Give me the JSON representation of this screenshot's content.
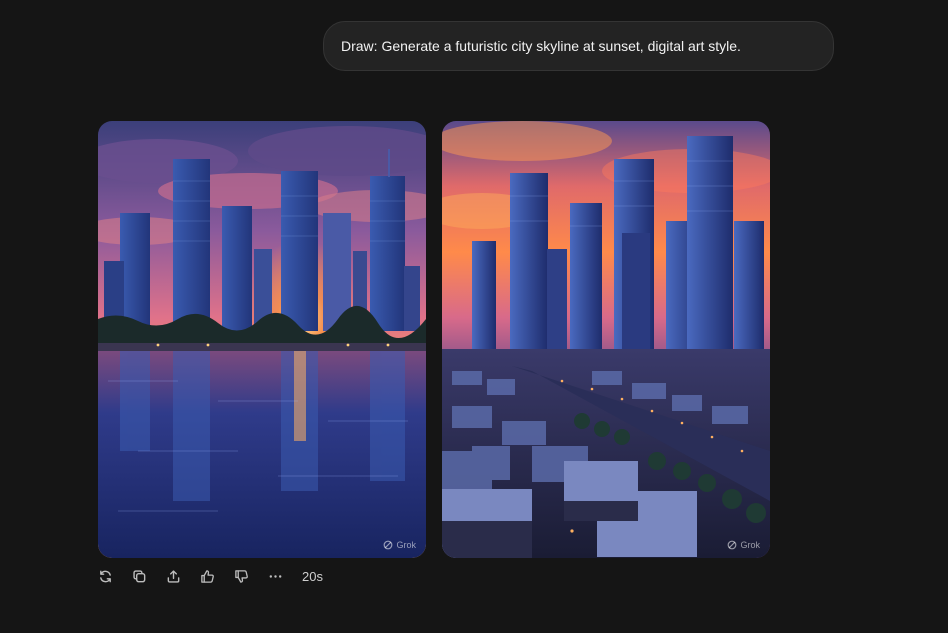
{
  "user_message": {
    "text": "Draw: Generate a futuristic city skyline at sunset, digital art style."
  },
  "images": [
    {
      "alt": "Futuristic city skyline at sunset reflected in a river",
      "watermark": "Grok"
    },
    {
      "alt": "Aerial futuristic city skyline at sunset with river and low-rise blocks",
      "watermark": "Grok"
    }
  ],
  "actions": {
    "icons": [
      "regenerate-icon",
      "copy-icon",
      "share-icon",
      "thumbs-up-icon",
      "thumbs-down-icon",
      "more-icon"
    ],
    "elapsed": "20s"
  }
}
